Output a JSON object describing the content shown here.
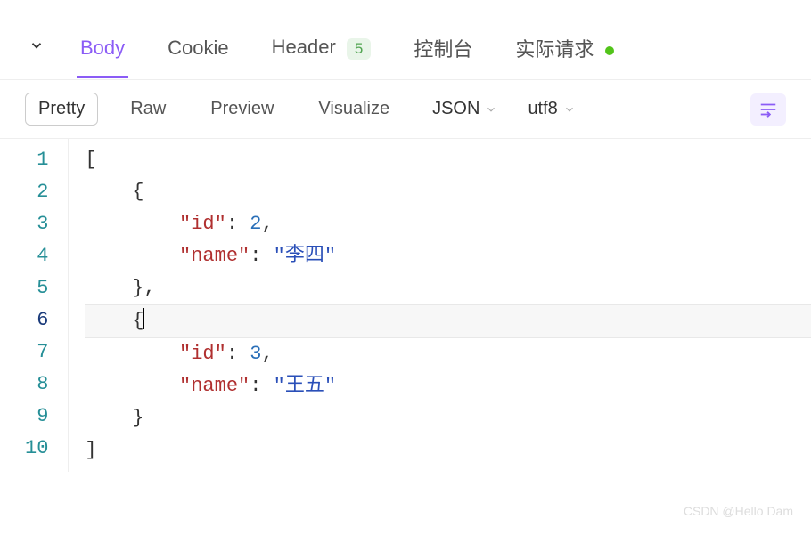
{
  "tabs": {
    "body": "Body",
    "cookie": "Cookie",
    "header": "Header",
    "header_badge": "5",
    "console": "控制台",
    "actual_request": "实际请求"
  },
  "format_bar": {
    "pretty": "Pretty",
    "raw": "Raw",
    "preview": "Preview",
    "visualize": "Visualize",
    "type": "JSON",
    "encoding": "utf8"
  },
  "code": {
    "lines": [
      "[",
      "    {",
      "        \"id\": 2,",
      "        \"name\": \"李四\"",
      "    },",
      "    {",
      "        \"id\": 3,",
      "        \"name\": \"王五\"",
      "    }",
      "]"
    ],
    "current_line": 6,
    "json_value": [
      {
        "id": 2,
        "name": "李四"
      },
      {
        "id": 3,
        "name": "王五"
      }
    ]
  },
  "watermark": "CSDN @Hello Dam"
}
